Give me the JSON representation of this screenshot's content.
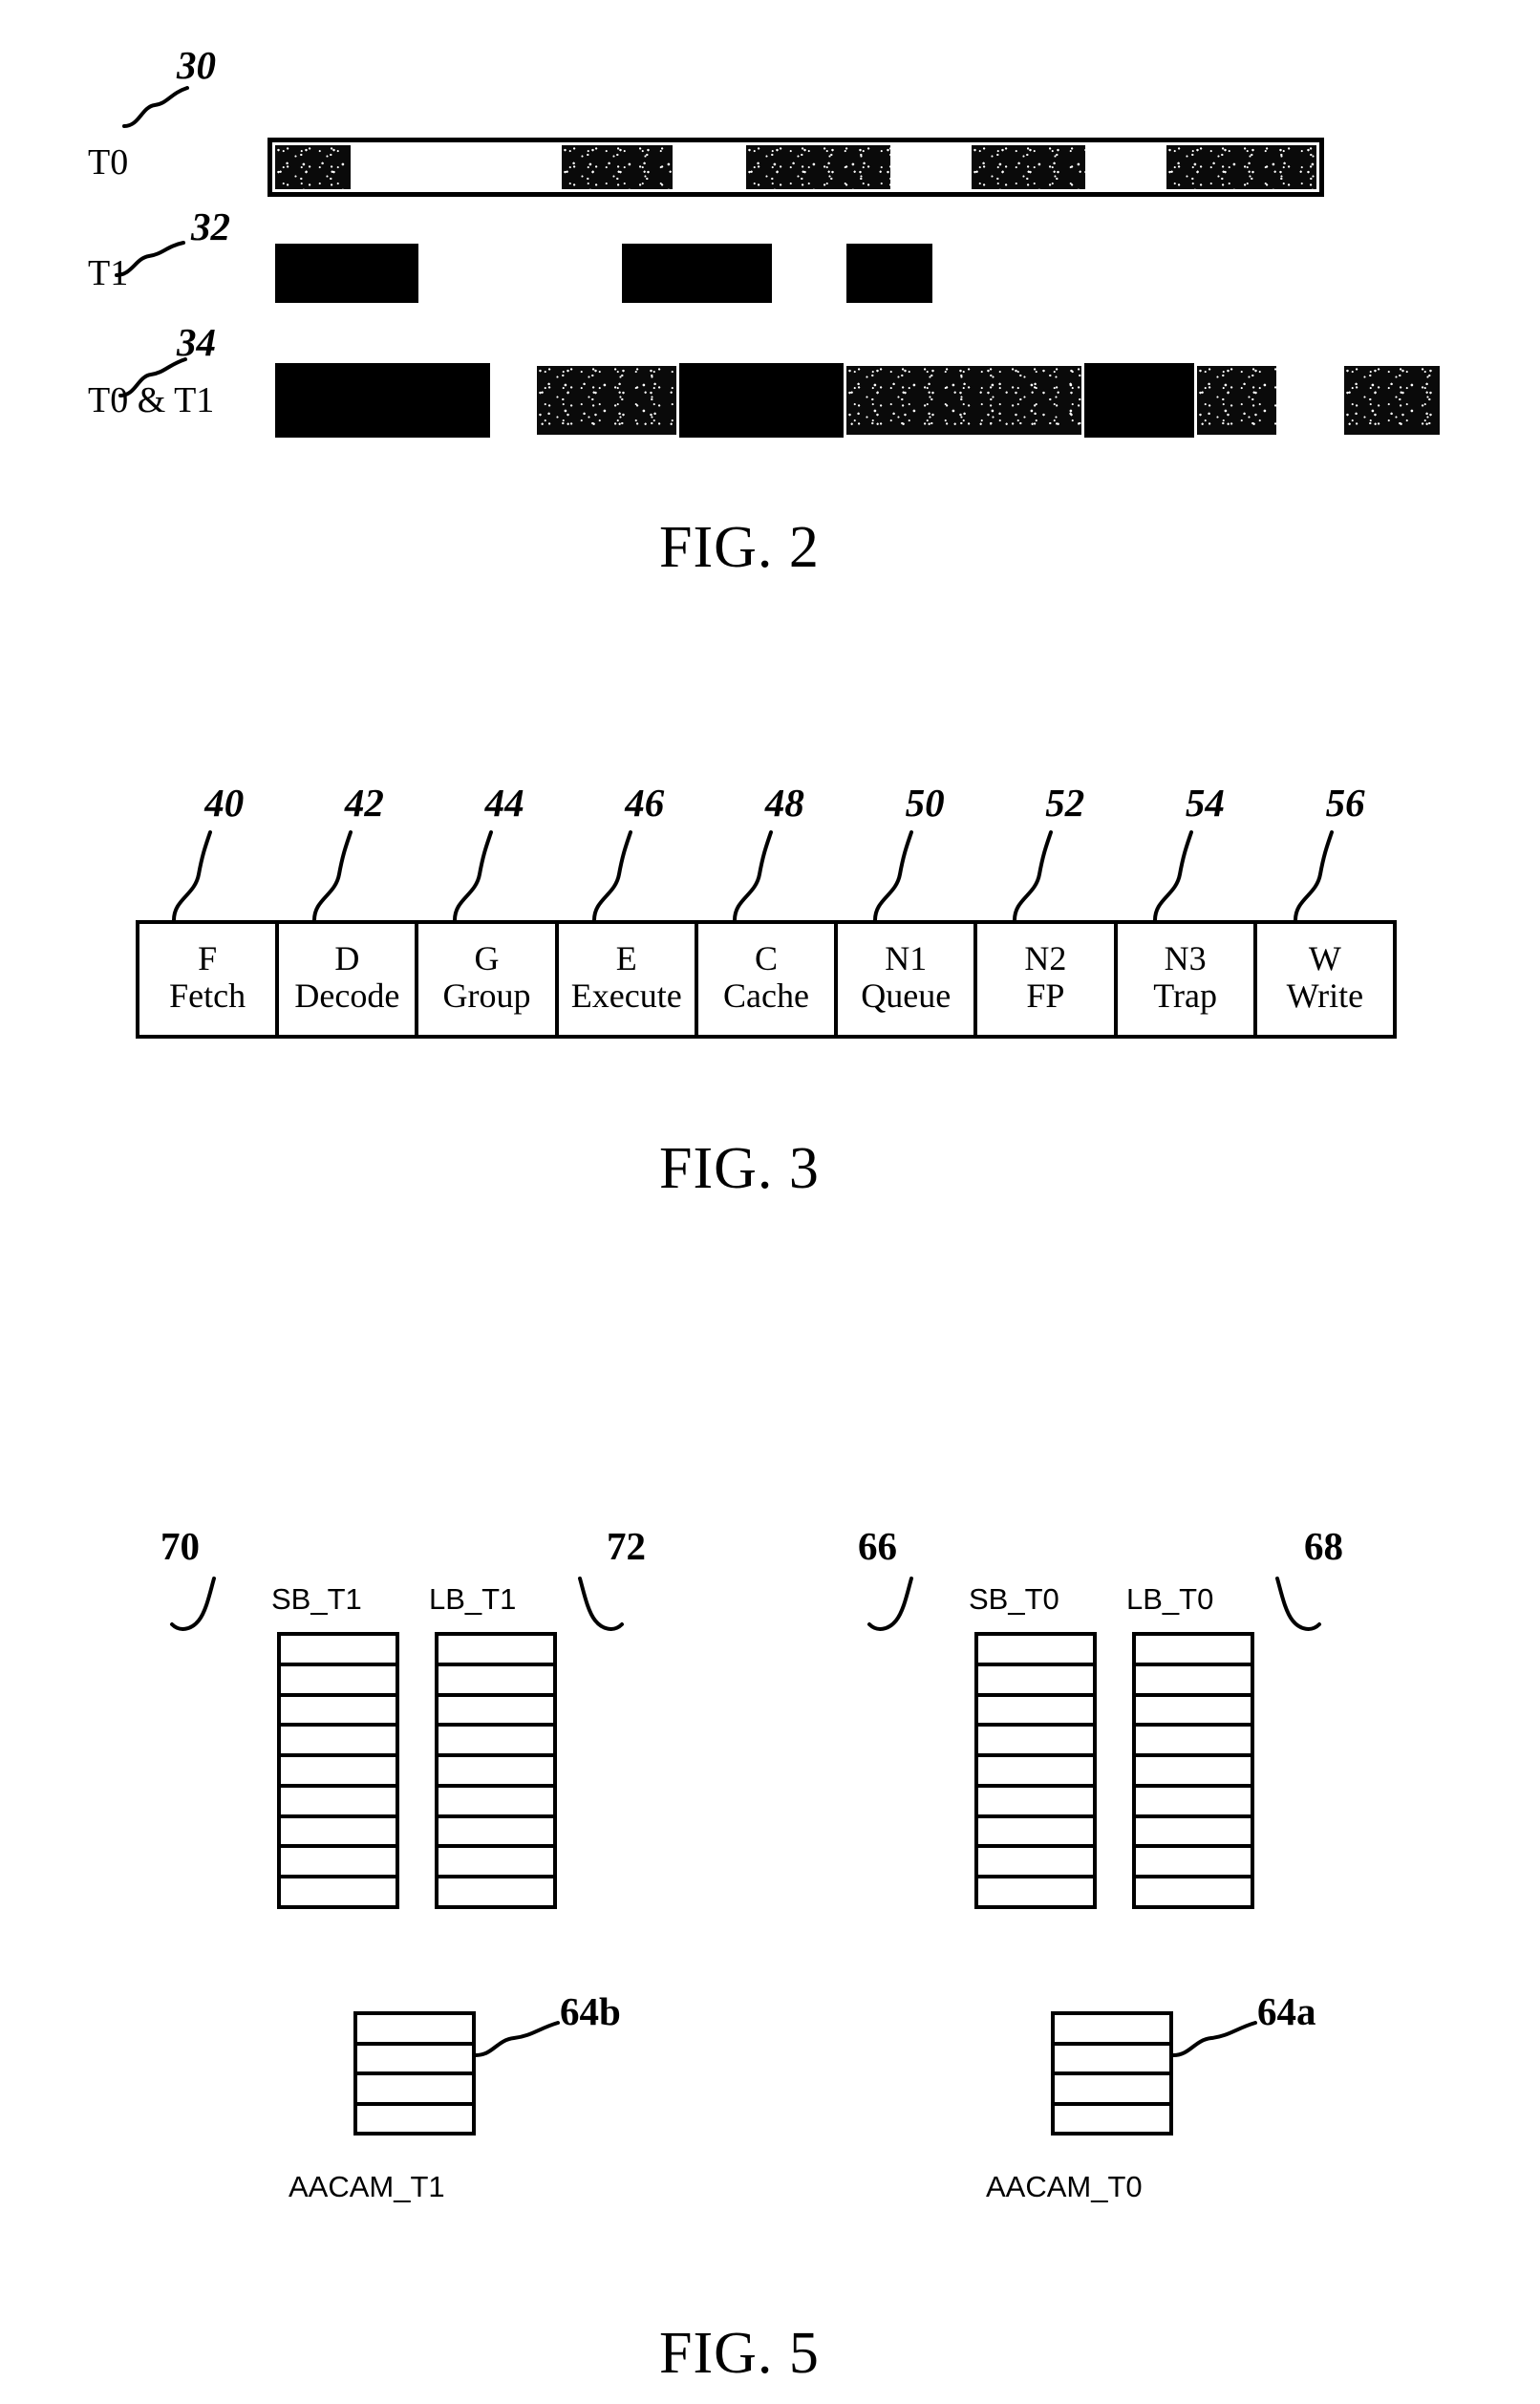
{
  "document": {
    "kind": "patent-drawing-sheet",
    "background_color": "#ffffff",
    "ink_color": "#000000"
  },
  "figures": [
    {
      "id": "fig2",
      "title": "FIG. 2",
      "rows": [
        {
          "label": "T0",
          "ref": "30",
          "style": "framed",
          "segments": [
            {
              "fill": "tex",
              "width_pct": 7.8
            },
            {
              "fill": "white",
              "width_pct": 19.6
            },
            {
              "fill": "tex",
              "width_pct": 11.1
            },
            {
              "fill": "white",
              "width_pct": 6.5
            },
            {
              "fill": "tex",
              "width_pct": 14.3
            },
            {
              "fill": "white",
              "width_pct": 7.2
            },
            {
              "fill": "tex",
              "width_pct": 11.4
            },
            {
              "fill": "white",
              "width_pct": 7.2
            },
            {
              "fill": "tex",
              "width_pct": 14.9
            }
          ]
        },
        {
          "label": "T1",
          "ref": "32",
          "style": "open",
          "segments": [
            {
              "fill": "black",
              "width_pct": 16.6
            },
            {
              "fill": "white",
              "width_pct": 23.6
            },
            {
              "fill": "black",
              "width_pct": 17.3
            },
            {
              "fill": "white",
              "width_pct": 8.7
            },
            {
              "fill": "black",
              "width_pct": 9.9
            },
            {
              "fill": "white",
              "width_pct": 23.9
            }
          ]
        },
        {
          "label": "T0 & T1",
          "ref": "34",
          "style": "open",
          "segments": [
            {
              "fill": "black",
              "width_pct": 18.4
            },
            {
              "fill": "white",
              "width_pct": 3.8
            },
            {
              "fill": "tex",
              "width_pct": 12.4
            },
            {
              "fill": "black",
              "width_pct": 14.1
            },
            {
              "fill": "tex",
              "width_pct": 20.6
            },
            {
              "fill": "black",
              "width_pct": 9.4
            },
            {
              "fill": "tex",
              "width_pct": 7.3
            },
            {
              "fill": "white",
              "width_pct": 5.3
            },
            {
              "fill": "tex",
              "width_pct": 8.7
            }
          ]
        }
      ]
    },
    {
      "id": "fig3",
      "title": "FIG. 3",
      "refs": [
        "40",
        "42",
        "44",
        "46",
        "48",
        "50",
        "52",
        "54",
        "56"
      ],
      "stages": [
        {
          "abbr": "F",
          "full": "Fetch"
        },
        {
          "abbr": "D",
          "full": "Decode"
        },
        {
          "abbr": "G",
          "full": "Group"
        },
        {
          "abbr": "E",
          "full": "Execute"
        },
        {
          "abbr": "C",
          "full": "Cache"
        },
        {
          "abbr": "N1",
          "full": "Queue"
        },
        {
          "abbr": "N2",
          "full": "FP"
        },
        {
          "abbr": "N3",
          "full": "Trap"
        },
        {
          "abbr": "W",
          "full": "Write"
        }
      ]
    },
    {
      "id": "fig5",
      "title": "FIG. 5",
      "buffers": [
        {
          "name": "SB_T1",
          "ref": "70",
          "ref_side": "left",
          "rows": 9
        },
        {
          "name": "LB_T1",
          "ref": "72",
          "ref_side": "right",
          "rows": 9
        },
        {
          "name": "SB_T0",
          "ref": "66",
          "ref_side": "left",
          "rows": 9
        },
        {
          "name": "LB_T0",
          "ref": "68",
          "ref_side": "right",
          "rows": 9
        }
      ],
      "cams": [
        {
          "name": "AACAM_T1",
          "ref": "64b",
          "rows": 4
        },
        {
          "name": "AACAM_T0",
          "ref": "64a",
          "rows": 4
        }
      ]
    }
  ]
}
